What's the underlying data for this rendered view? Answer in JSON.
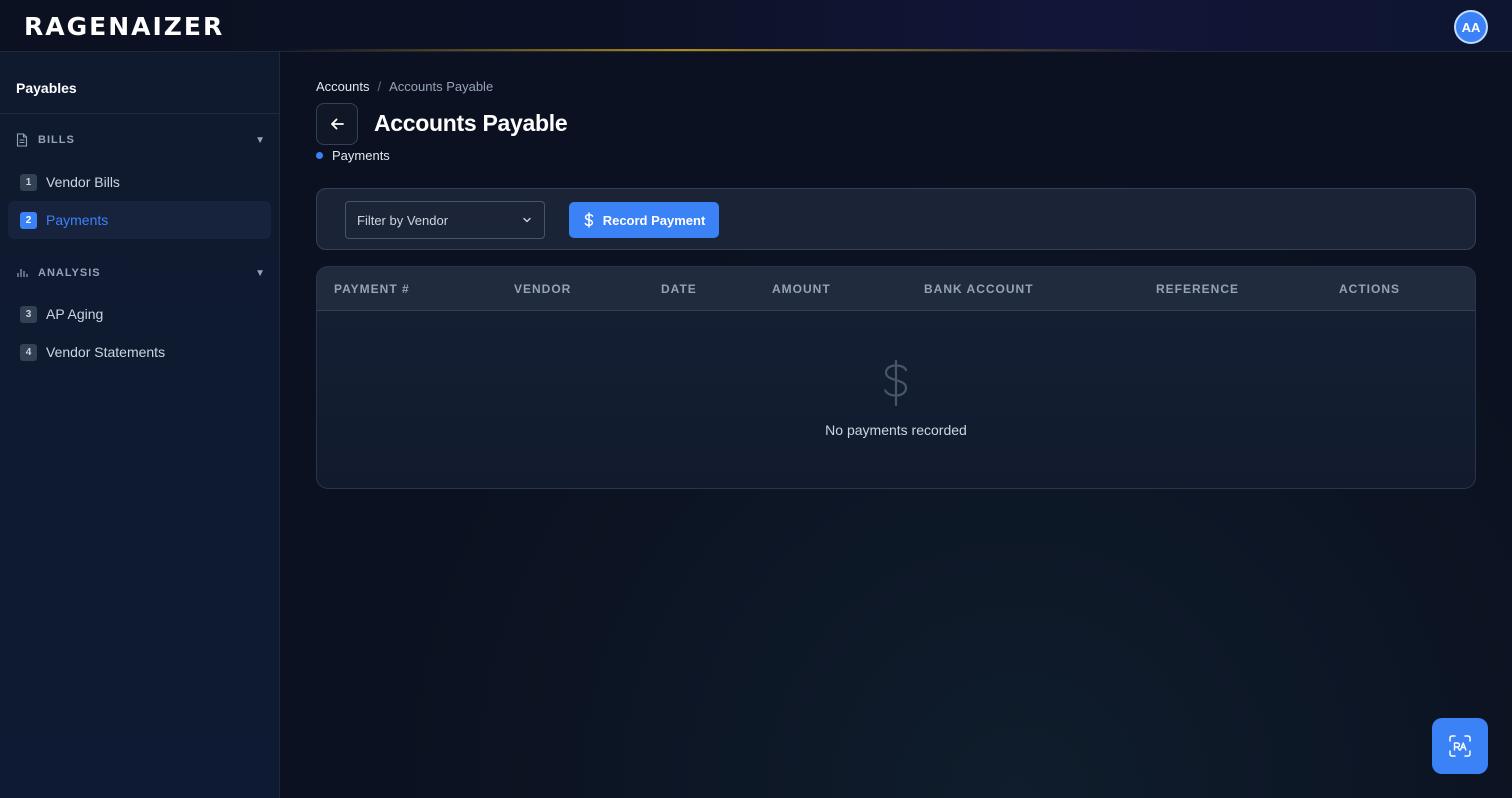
{
  "app": {
    "logo_text": "RAGENAIZER",
    "user_initials": "AA"
  },
  "sidebar": {
    "title": "Payables",
    "sections": [
      {
        "label": "BILLS",
        "icon": "document-icon",
        "items": [
          {
            "number": "1",
            "label": "Vendor Bills"
          },
          {
            "number": "2",
            "label": "Payments",
            "active": true
          }
        ]
      },
      {
        "label": "ANALYSIS",
        "icon": "bar-chart-icon",
        "items": [
          {
            "number": "3",
            "label": "AP Aging"
          },
          {
            "number": "4",
            "label": "Vendor Statements"
          }
        ]
      }
    ]
  },
  "breadcrumb": {
    "parent": "Accounts",
    "separator": "/",
    "current": "Accounts Payable"
  },
  "page": {
    "title": "Accounts Payable",
    "active_tab": "Payments"
  },
  "toolbar": {
    "vendor_filter_placeholder": "Filter by Vendor",
    "record_button": "Record Payment"
  },
  "table": {
    "columns": [
      "PAYMENT #",
      "VENDOR",
      "DATE",
      "AMOUNT",
      "BANK ACCOUNT",
      "REFERENCE",
      "ACTIONS"
    ],
    "rows": [],
    "empty_message": "No payments recorded"
  },
  "colors": {
    "accent": "#3b82f6",
    "background": "#0b1120"
  }
}
